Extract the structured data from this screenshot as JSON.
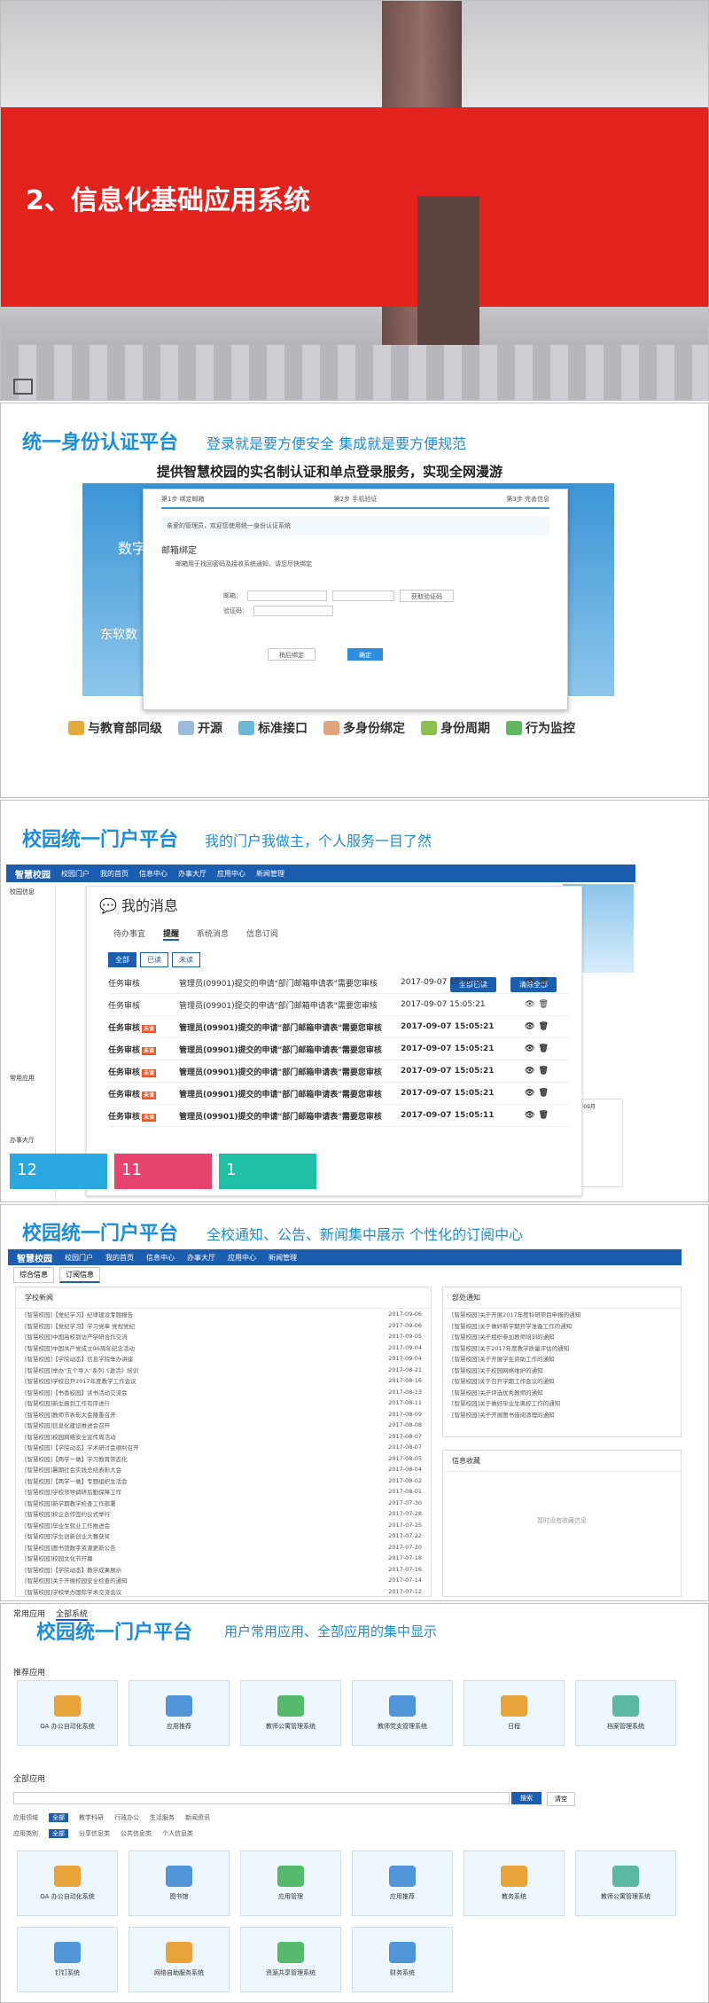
{
  "slide1": {
    "title": "2、信息化基础应用系统"
  },
  "slide2": {
    "heading": "统一身份认证平台",
    "subtitle": "登录就是要方便安全  集成就是要方便规范",
    "tagline": "提供智慧校园的实名制认证和单点登录服务，实现全网漫游",
    "steps": [
      "第1步 绑定邮箱",
      "第2步 手机验证",
      "第3步 完善信息"
    ],
    "welcome": "亲爱的管理员，欢迎您使用统一身份认证系统",
    "bind_title": "邮箱绑定",
    "bind_desc": "邮箱用于找回密码及接收系统通知，请您尽快绑定",
    "email_label": "邮箱：",
    "code_label": "验证码：",
    "get_code": "获取验证码",
    "skip": "稍后绑定",
    "confirm": "确定",
    "bg_text": "数字",
    "bg_text2": "东软数",
    "features": [
      "与教育部同级",
      "开源",
      "标准接口",
      "多身份绑定",
      "身份周期",
      "行为监控"
    ]
  },
  "slide3": {
    "heading": "校园统一门户平台",
    "subtitle": "我的门户我做主，个人服务一目了然",
    "app_name": "智慧校园",
    "nav": [
      "校园门户",
      "我的首页",
      "信息中心",
      "办事大厅",
      "应用中心",
      "新闻管理"
    ],
    "panel_title": "我的消息",
    "tabs": [
      "待办事宜",
      "提醒",
      "系统消息",
      "信息订阅"
    ],
    "filters": [
      "全部",
      "已读",
      "未读"
    ],
    "read_all": "全部已读",
    "clear_all": "清除全部",
    "rows": [
      {
        "type": "任务审核",
        "content": "管理员(09901)提交的申请\"部门邮箱申请表\"需要您审核",
        "date": "2017-09-07 15:06:01",
        "bold": false
      },
      {
        "type": "任务审核",
        "content": "管理员(09901)提交的申请\"部门邮箱申请表\"需要您审核",
        "date": "2017-09-07 15:05:21",
        "bold": false
      },
      {
        "type": "任务审核",
        "content": "管理员(09901)提交的申请\"部门邮箱申请表\"需要您审核",
        "date": "2017-09-07 15:05:21",
        "bold": true
      },
      {
        "type": "任务审核",
        "content": "管理员(09901)提交的申请\"部门邮箱申请表\"需要您审核",
        "date": "2017-09-07 15:05:21",
        "bold": true
      },
      {
        "type": "任务审核",
        "content": "管理员(09901)提交的申请\"部门邮箱申请表\"需要您审核",
        "date": "2017-09-07 15:05:21",
        "bold": true
      },
      {
        "type": "任务审核",
        "content": "管理员(09901)提交的申请\"部门邮箱申请表\"需要您审核",
        "date": "2017-09-07 15:05:21",
        "bold": true
      },
      {
        "type": "任务审核",
        "content": "管理员(09901)提交的申请\"部门邮箱申请表\"需要您审核",
        "date": "2017-09-07 15:05:11",
        "bold": true
      }
    ],
    "new_tag": "未读",
    "cards": [
      "12",
      "11",
      "1"
    ],
    "sidebar_title": "校园信息",
    "left_label": "常用应用",
    "office": "办事大厅",
    "calendar_title": "2017年09月"
  },
  "slide4": {
    "heading": "校园统一门户平台",
    "subtitle": "全校通知、公告、新闻集中展示 个性化的订阅中心",
    "app_name": "智慧校园",
    "nav": [
      "校园门户",
      "我的首页",
      "信息中心",
      "办事大厅",
      "应用中心",
      "新闻管理"
    ],
    "tabs": [
      "综合信息",
      "订阅信息"
    ],
    "news_title": "学校新闻",
    "notice_title": "部处通知",
    "collect_title": "信息收藏",
    "collect_empty": "暂时没有收藏信息",
    "news": [
      [
        "[智慧校园]【党纪学习】纪律建设专题报告",
        "2017-09-06"
      ],
      [
        "[智慧校园]【党纪学习】学习党章 党规党纪",
        "2017-09-06"
      ],
      [
        "[智慧校园]中国高校到访产学研合作交流",
        "2017-09-05"
      ],
      [
        "[智慧校园]中国共产党成立96周年纪念活动",
        "2017-09-04"
      ],
      [
        "[智慧校园]【学院动态】信息学院举办讲座",
        "2017-09-04"
      ],
      [
        "[智慧校园]举办\"五个导入\"系列《激活》培训",
        "2017-08-21"
      ],
      [
        "[智慧校园]学校召开2017年度教学工作会议",
        "2017-08-16"
      ],
      [
        "[智慧校园]【书香校园】读书活动交流会",
        "2017-08-13"
      ],
      [
        "[智慧校园]新生报到工作有序进行",
        "2017-08-11"
      ],
      [
        "[智慧校园]教师节表彰大会隆重召开",
        "2017-08-09"
      ],
      [
        "[智慧校园]信息化建设推进会召开",
        "2017-08-08"
      ],
      [
        "[智慧校园]校园网络安全宣传周活动",
        "2017-08-07"
      ],
      [
        "[智慧校园]【学院动态】学术研讨会顺利召开",
        "2017-08-07"
      ],
      [
        "[智慧校园]【两学一做】学习教育常态化",
        "2017-08-05"
      ],
      [
        "[智慧校园]暑期社会实践总结表彰大会",
        "2017-08-04"
      ],
      [
        "[智慧校园]【两学一做】专题组织生活会",
        "2017-08-02"
      ],
      [
        "[智慧校园]学校领导调研后勤保障工作",
        "2017-08-01"
      ],
      [
        "[智慧校园]新学期教学检查工作部署",
        "2017-07-30"
      ],
      [
        "[智慧校园]校企合作签约仪式举行",
        "2017-07-28"
      ],
      [
        "[智慧校园]毕业生就业工作推进会",
        "2017-07-25"
      ],
      [
        "[智慧校园]学生创新创业大赛获奖",
        "2017-07-22"
      ],
      [
        "[智慧校园]图书馆数字资源更新公告",
        "2017-07-20"
      ],
      [
        "[智慧校园]校园文化节开幕",
        "2017-07-18"
      ],
      [
        "[智慧校园]【学院动态】教学成果展示",
        "2017-07-16"
      ],
      [
        "[智慧校园]关于开展校园安全检查的通知",
        "2017-07-14"
      ],
      [
        "[智慧校园]学校举办国际学术交流会议",
        "2017-07-12"
      ]
    ],
    "notices": [
      "[智慧校园]关于开展2017年度科研项目申报的通知",
      "[智慧校园]关于做好新学期开学准备工作的通知",
      "[智慧校园]关于组织参加教师培训的通知",
      "[智慧校园]关于2017年度教学质量评估的通知",
      "[智慧校园]关于开展学生资助工作的通知",
      "[智慧校园]关于校园网络维护的通知",
      "[智慧校园]关于召开学期工作会议的通知",
      "[智慧校园]关于评选优秀教师的通知",
      "[智慧校园]关于做好毕业生离校工作的通知",
      "[智慧校园]关于开展图书借阅清理的通知"
    ]
  },
  "slide5": {
    "heading": "校园统一门户平台",
    "subtitle": "用户常用应用、全部应用的集中显示",
    "tabs": [
      "常用应用",
      "全部系统"
    ],
    "recommended": "推荐应用",
    "all_apps": "全部应用",
    "search_btn": "搜索",
    "clear_btn": "清空",
    "cat_label": "应用领域",
    "cat_items": [
      "全部",
      "教学科研",
      "行政办公",
      "生活服务",
      "新闻资讯"
    ],
    "type_label": "应用类别",
    "type_items": [
      "全部",
      "分享信息类",
      "公共信息类",
      "个人信息类"
    ],
    "rec_apps": [
      "OA 办公自动化系统",
      "应用推荐",
      "教师公寓管理系统",
      "教师党支管理系统",
      "日程",
      "档案管理系统"
    ],
    "all_list": [
      "OA 办公自动化系统",
      "图书馆",
      "应用管理",
      "应用推荐",
      "教务系统",
      "教师公寓管理系统",
      "钉钉系统",
      "网络自助服务系统",
      "资源共享管理系统",
      "财务系统"
    ]
  }
}
